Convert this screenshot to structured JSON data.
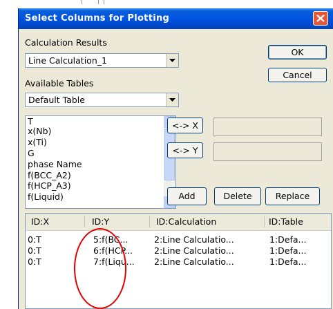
{
  "dialog": {
    "title": "Select Columns for Plotting",
    "close_label": "✕"
  },
  "calculation_results": {
    "label": "Calculation Results",
    "selected": "Line Calculation_1"
  },
  "available_tables": {
    "label": "Available Tables",
    "selected": "Default Table"
  },
  "buttons": {
    "ok": "OK",
    "cancel": "Cancel",
    "set_x": "<-> X",
    "set_y": "<-> Y",
    "add": "Add",
    "delete": "Delete",
    "replace": "Replace"
  },
  "column_list": {
    "items": [
      "T",
      "x(Nb)",
      "x(Ti)",
      "G",
      "phase Name",
      "f(BCC_A2)",
      "f(HCP_A3)",
      "f(Liquid)"
    ]
  },
  "x_field": {
    "value": ""
  },
  "y_field": {
    "value": ""
  },
  "selection_table": {
    "headers": [
      "ID:X",
      "ID:Y",
      "ID:Calculation",
      "ID:Table"
    ],
    "rows": [
      [
        "0:T",
        "5:f(BC...",
        "2:Line Calculatio...",
        "1:Defa..."
      ],
      [
        "0:T",
        "6:f(HCP...",
        "2:Line Calculatio...",
        "1:Defa..."
      ],
      [
        "0:T",
        "7:f(Liqu...",
        "2:Line Calculatio...",
        "1:Defa..."
      ]
    ]
  },
  "colors": {
    "titlebar": "#0054e3",
    "dialog_face": "#ece9d8",
    "close_button": "#e35a3a",
    "annotation": "#e00000"
  }
}
